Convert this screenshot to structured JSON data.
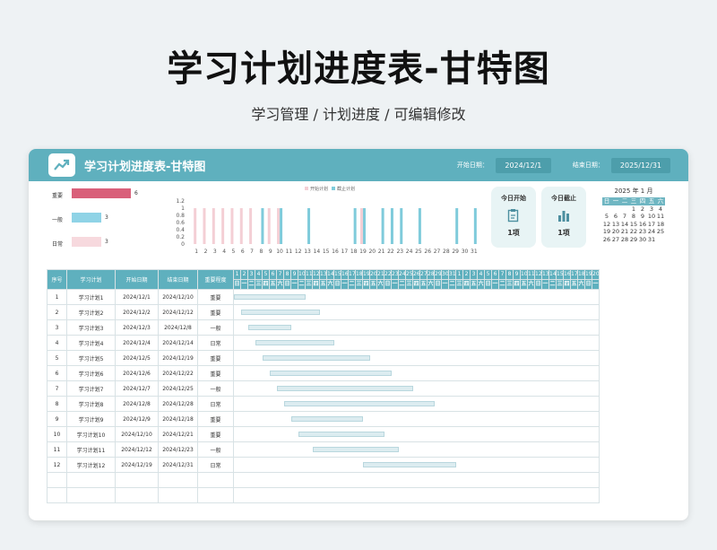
{
  "page": {
    "title": "学习计划进度表-甘特图",
    "subtitle": "学习管理 / 计划进度 / 可编辑修改"
  },
  "header": {
    "title": "学习计划进度表-甘特图",
    "start_label": "开始日期：",
    "start_date": "2024/12/1",
    "end_label": "结束日期：",
    "end_date": "2025/12/31",
    "logo_icon": "trend-up-icon"
  },
  "legend": {
    "items": [
      {
        "label": "重要",
        "count": "6",
        "value": 6,
        "color": "#d9607a"
      },
      {
        "label": "一般",
        "count": "3",
        "value": 3,
        "color": "#8fd3e6"
      },
      {
        "label": "日常",
        "count": "3",
        "value": 3,
        "color": "#f7d9de"
      }
    ]
  },
  "chart_data": {
    "type": "bar",
    "series": [
      {
        "name": "开始计划",
        "color": "#f4cfd5",
        "values": [
          1,
          1,
          1,
          1,
          1,
          1,
          1,
          0,
          1,
          1,
          0,
          0,
          0,
          0,
          0,
          0,
          0,
          0,
          1,
          0,
          0,
          0,
          0,
          0,
          0,
          0,
          0,
          0,
          0,
          0,
          0
        ]
      },
      {
        "name": "截止计划",
        "color": "#7fcbdb",
        "values": [
          0,
          0,
          0,
          0,
          0,
          0,
          0,
          1,
          0,
          1,
          0,
          0,
          1,
          0,
          0,
          0,
          0,
          1,
          1,
          0,
          1,
          1,
          1,
          0,
          1,
          0,
          0,
          0,
          1,
          0,
          1
        ]
      }
    ],
    "categories": [
      "1",
      "2",
      "3",
      "4",
      "5",
      "6",
      "7",
      "8",
      "9",
      "10",
      "11",
      "12",
      "13",
      "14",
      "15",
      "16",
      "17",
      "18",
      "19",
      "20",
      "21",
      "22",
      "23",
      "24",
      "25",
      "26",
      "27",
      "28",
      "29",
      "30",
      "31"
    ],
    "yticks": [
      "1.2",
      "1",
      "0.8",
      "0.6",
      "0.4",
      "0.2",
      "0"
    ],
    "ylim": [
      0,
      1.2
    ]
  },
  "stats": [
    {
      "label": "今日开始",
      "value": "1项",
      "icon": "clipboard-icon"
    },
    {
      "label": "今日截止",
      "value": "1项",
      "icon": "bar-chart-icon"
    }
  ],
  "calendar": {
    "year": "2025",
    "year_suffix": "年",
    "month": "1",
    "month_suffix": "月",
    "weekdays": [
      "日",
      "一",
      "二",
      "三",
      "四",
      "五",
      "六"
    ],
    "days": [
      "",
      "",
      "",
      "1",
      "2",
      "3",
      "4",
      "5",
      "6",
      "7",
      "8",
      "9",
      "10",
      "11",
      "12",
      "13",
      "14",
      "15",
      "16",
      "17",
      "18",
      "19",
      "20",
      "21",
      "22",
      "23",
      "24",
      "25",
      "26",
      "27",
      "28",
      "29",
      "30",
      "31",
      ""
    ]
  },
  "table": {
    "headers": [
      "序号",
      "学习计划",
      "开始日期",
      "结束日期",
      "重要程度"
    ],
    "day_numbers": [
      "1",
      "2",
      "3",
      "4",
      "5",
      "6",
      "7",
      "8",
      "9",
      "10",
      "11",
      "12",
      "13",
      "14",
      "15",
      "16",
      "17",
      "18",
      "19",
      "20",
      "21",
      "22",
      "23",
      "24",
      "25",
      "26",
      "27",
      "28",
      "29",
      "30",
      "31",
      "1",
      "2",
      "3",
      "4",
      "5",
      "6",
      "7",
      "8",
      "9",
      "10",
      "11",
      "12",
      "13",
      "14",
      "15",
      "16",
      "17",
      "18",
      "19",
      "20"
    ],
    "weekday_row": [
      "日",
      "一",
      "二",
      "三",
      "四",
      "五",
      "六",
      "日",
      "一",
      "二",
      "三",
      "四",
      "五",
      "六",
      "日",
      "一",
      "二",
      "三",
      "四",
      "五",
      "六",
      "日",
      "一",
      "二",
      "三",
      "四",
      "五",
      "六",
      "日",
      "一",
      "二",
      "三",
      "四",
      "五",
      "六",
      "日",
      "一",
      "二",
      "三",
      "四",
      "五",
      "六",
      "日",
      "一",
      "二",
      "三",
      "四",
      "五",
      "六",
      "日",
      "一"
    ],
    "rows": [
      {
        "no": "1",
        "name": "学习计划1",
        "start": "2024/12/1",
        "end": "2024/12/10",
        "level": "重要",
        "s": 1,
        "e": 10
      },
      {
        "no": "2",
        "name": "学习计划2",
        "start": "2024/12/2",
        "end": "2024/12/12",
        "level": "重要",
        "s": 2,
        "e": 12
      },
      {
        "no": "3",
        "name": "学习计划3",
        "start": "2024/12/3",
        "end": "2024/12/8",
        "level": "一般",
        "s": 3,
        "e": 8
      },
      {
        "no": "4",
        "name": "学习计划4",
        "start": "2024/12/4",
        "end": "2024/12/14",
        "level": "日常",
        "s": 4,
        "e": 14
      },
      {
        "no": "5",
        "name": "学习计划5",
        "start": "2024/12/5",
        "end": "2024/12/19",
        "level": "重要",
        "s": 5,
        "e": 19
      },
      {
        "no": "6",
        "name": "学习计划6",
        "start": "2024/12/6",
        "end": "2024/12/22",
        "level": "重要",
        "s": 6,
        "e": 22
      },
      {
        "no": "7",
        "name": "学习计划7",
        "start": "2024/12/7",
        "end": "2024/12/25",
        "level": "一般",
        "s": 7,
        "e": 25
      },
      {
        "no": "8",
        "name": "学习计划8",
        "start": "2024/12/8",
        "end": "2024/12/28",
        "level": "日常",
        "s": 8,
        "e": 28
      },
      {
        "no": "9",
        "name": "学习计划9",
        "start": "2024/12/9",
        "end": "2024/12/18",
        "level": "重要",
        "s": 9,
        "e": 18
      },
      {
        "no": "10",
        "name": "学习计划10",
        "start": "2024/12/10",
        "end": "2024/12/21",
        "level": "重要",
        "s": 10,
        "e": 21
      },
      {
        "no": "11",
        "name": "学习计划11",
        "start": "2024/12/12",
        "end": "2024/12/23",
        "level": "一般",
        "s": 12,
        "e": 23
      },
      {
        "no": "12",
        "name": "学习计划12",
        "start": "2024/12/19",
        "end": "2024/12/31",
        "level": "日常",
        "s": 19,
        "e": 31
      }
    ]
  }
}
